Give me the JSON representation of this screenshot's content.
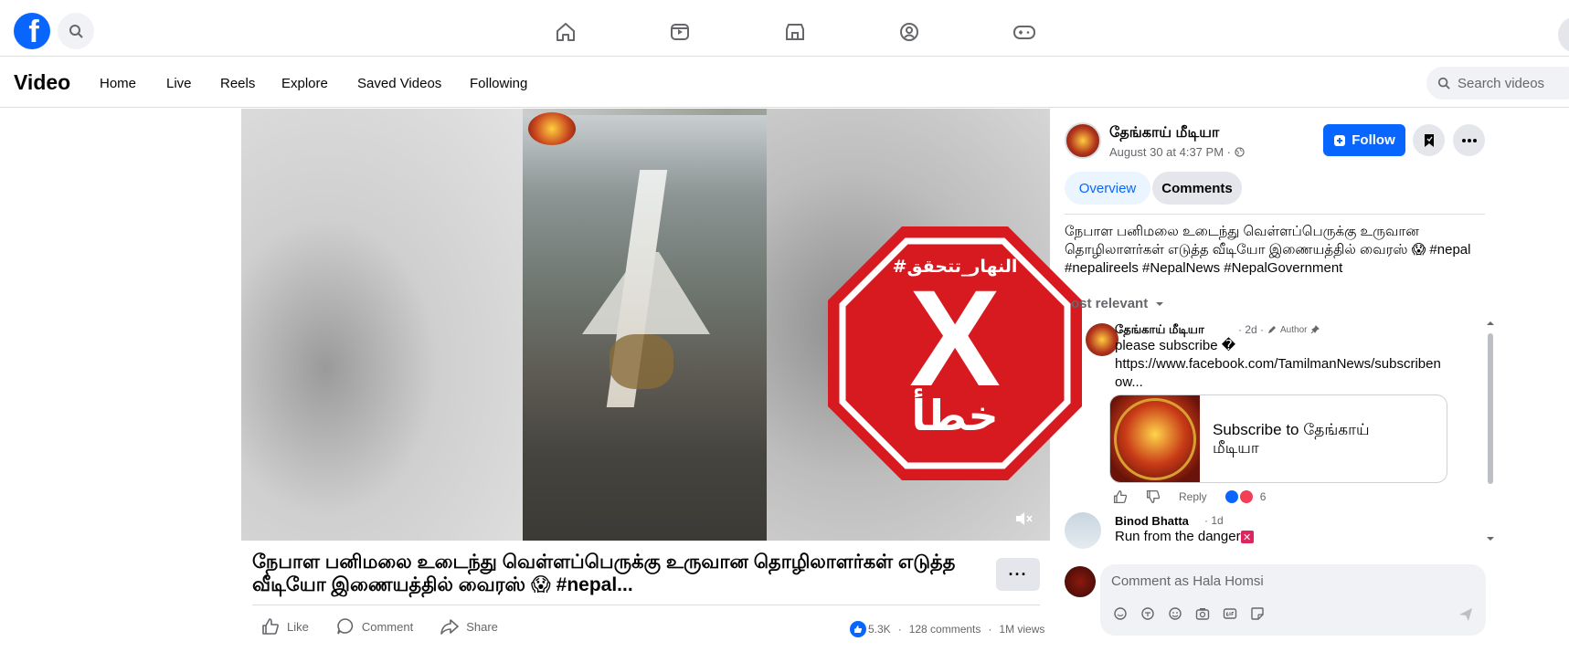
{
  "topnav": {
    "logo": "f",
    "icons": [
      "home-icon",
      "video-icon",
      "marketplace-icon",
      "groups-icon",
      "gaming-icon"
    ]
  },
  "video_nav": {
    "title": "Video",
    "links": [
      "Home",
      "Live",
      "Reels",
      "Explore",
      "Saved Videos",
      "Following"
    ],
    "search_placeholder": "Search videos"
  },
  "video": {
    "overlay_text_top": "#النهار_تتحقق",
    "overlay_text_bottom": "خطأ",
    "overlay_mark": "X",
    "title": "நேபாள பனிமலை உடைந்து வெள்ளப்பெருக்கு உருவான தொழிலாளர்கள் எடுத்த வீடியோ இணையத்தில் வைரஸ் 😱 #nepal...",
    "more": "···",
    "actions": {
      "like": "Like",
      "comment": "Comment",
      "share": "Share"
    },
    "stats": {
      "reactions": "5.3K",
      "comments": "128 comments",
      "views": "1M views"
    }
  },
  "post": {
    "page_name": "தேங்காய் மீடியா",
    "time": "August 30 at 4:37 PM ·",
    "follow": "Follow",
    "tabs": {
      "overview": "Overview",
      "comments": "Comments"
    },
    "description": "நேபாள பனிமலை உடைந்து வெள்ளப்பெருக்கு உருவான தொழிலாளர்கள் எடுத்த வீடியோ இணையத்தில் வைரஸ் 😱 #nepal #nepalireels #NepalNews #NepalGovernment",
    "sort": "ost relevant"
  },
  "comments": [
    {
      "name": "தேங்காய் மீடியா",
      "age": "· 2d ·",
      "badge": "Author",
      "text": "please subscribe �",
      "link": "https://www.facebook.com/TamilmanNews/subscribenow...",
      "card_title": "Subscribe to தேங்காய் மீடியா",
      "reply": "Reply",
      "reaction_count": "6"
    },
    {
      "name": "Binod Bhatta",
      "age": "· 1d",
      "text": "Run from the danger",
      "emoji": "✕"
    }
  ],
  "composer": {
    "placeholder": "Comment as Hala Homsi"
  },
  "colors": {
    "brand": "#0866ff",
    "stop_sign": "#d71920"
  }
}
